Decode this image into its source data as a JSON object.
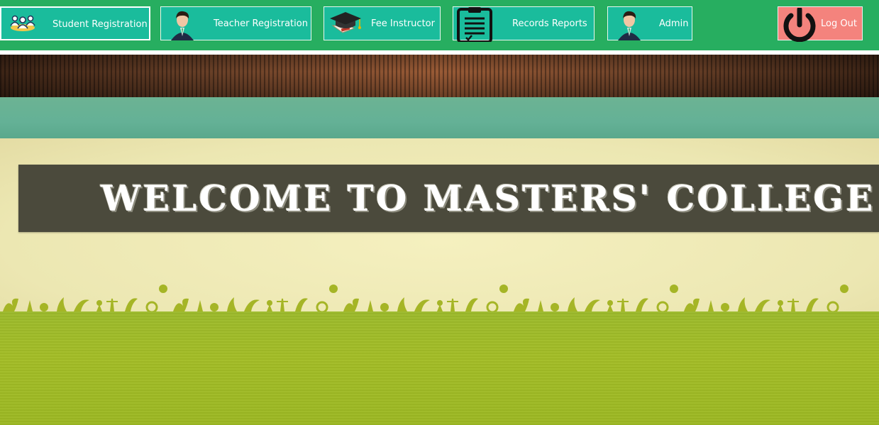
{
  "nav": {
    "student_registration": "Student Registration",
    "teacher_registration": "Teacher Registration",
    "fee_instructor": "Fee Instructor",
    "records_reports": "Records  Reports",
    "admin": "Admin",
    "logout": "Log Out"
  },
  "banner": {
    "welcome": "WELCOME TO MASTERS' COLLEGE"
  },
  "colors": {
    "nav_bg": "#27ae60",
    "button_bg": "#1abc9c",
    "logout_bg": "#f4837d"
  }
}
